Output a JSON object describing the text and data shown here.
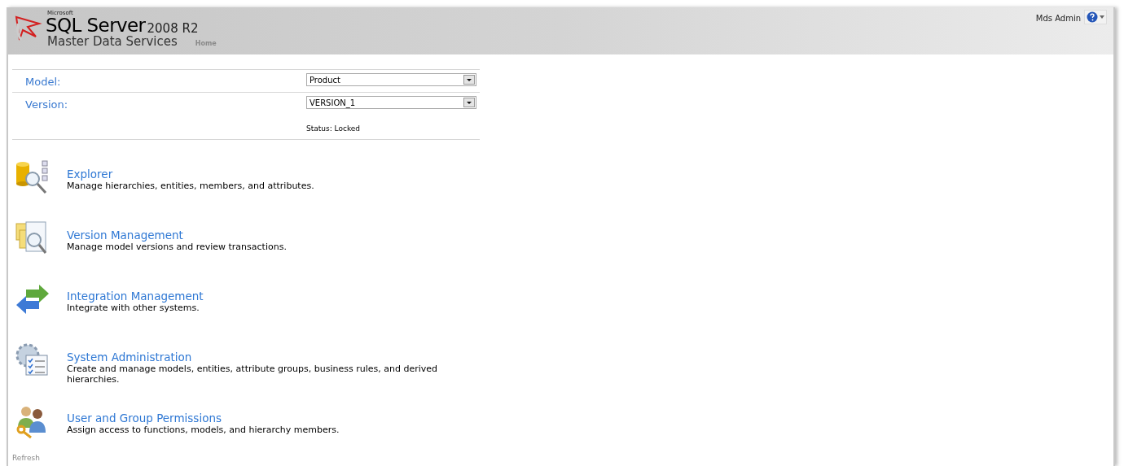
{
  "header": {
    "brand_small": "Microsoft",
    "brand_main": "SQL Server",
    "brand_version": "2008 R2",
    "product": "Master Data Services",
    "breadcrumb": "Home",
    "user": "Mds Admin"
  },
  "form": {
    "fields": [
      {
        "label": "Model:",
        "value": "Product"
      },
      {
        "label": "Version:",
        "value": "VERSION_1"
      }
    ],
    "status": "Status: Locked"
  },
  "functions": [
    {
      "kind": "explorer",
      "title": "Explorer",
      "description": "Manage hierarchies, entities, members, and attributes."
    },
    {
      "kind": "versions",
      "title": "Version Management",
      "description": "Manage model versions and review transactions."
    },
    {
      "kind": "integration",
      "title": "Integration Management",
      "description": "Integrate with other systems."
    },
    {
      "kind": "admin",
      "title": "System Administration",
      "description": "Create and manage models, entities, attribute groups, business rules, and derived hierarchies."
    },
    {
      "kind": "permissions",
      "title": "User and Group Permissions",
      "description": "Assign access to functions, models, and hierarchy members."
    }
  ],
  "footer": {
    "link": "Refresh"
  }
}
